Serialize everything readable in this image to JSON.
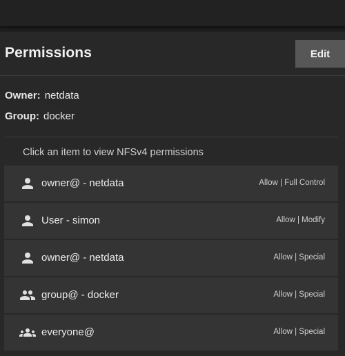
{
  "card": {
    "title": "Permissions",
    "edit_label": "Edit"
  },
  "owner": {
    "label": "Owner:",
    "value": "netdata"
  },
  "group": {
    "label": "Group:",
    "value": "docker"
  },
  "hint": "Click an item to view NFSv4 permissions",
  "acl_items": [
    {
      "icon": "person-icon",
      "name": "owner@ - netdata",
      "permission": "Allow | Full Control"
    },
    {
      "icon": "person-icon",
      "name": "User - simon",
      "permission": "Allow | Modify"
    },
    {
      "icon": "person-icon",
      "name": "owner@ - netdata",
      "permission": "Allow | Special"
    },
    {
      "icon": "people-icon",
      "name": "group@ - docker",
      "permission": "Allow | Special"
    },
    {
      "icon": "groups-icon",
      "name": "everyone@",
      "permission": "Allow | Special"
    }
  ],
  "colors": {
    "background": "#1e1e1e",
    "card": "#282828",
    "item": "#343434",
    "button": "#575757",
    "text": "#e8e8e8"
  }
}
